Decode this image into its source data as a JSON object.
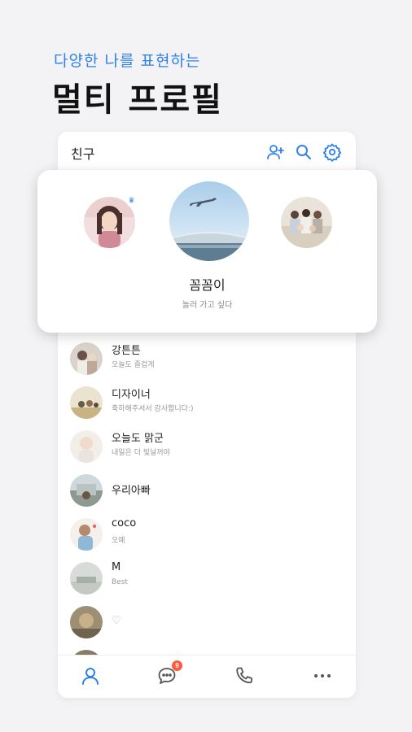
{
  "headline": {
    "subtitle": "다양한 나를 표현하는",
    "title": "멀티 프로필"
  },
  "topbar": {
    "title": "친구",
    "icons": [
      "add-friend-icon",
      "search-icon",
      "settings-icon"
    ]
  },
  "multi_profile": {
    "active_name": "꼼꼼이",
    "active_status": "놀러 가고 싶다",
    "profiles": [
      "profile-woman",
      "profile-airplane-sky",
      "profile-family"
    ],
    "crown_icon": "crown-icon"
  },
  "friends": [
    {
      "name": "강튼튼",
      "status": "오늘도 즐겁게"
    },
    {
      "name": "디자이너",
      "status": "축하해주셔서 감사합니다:)"
    },
    {
      "name": "오늘도 맑군",
      "status": "내일은 더 빛날꺼야"
    },
    {
      "name": "우리아빠",
      "status": ""
    },
    {
      "name": "coco",
      "status": "오예"
    },
    {
      "name": "M",
      "status": "Best"
    },
    {
      "name": "",
      "status": "♡"
    }
  ],
  "bottomnav": {
    "chat_badge": "9",
    "icons": [
      "friends-icon",
      "chat-icon",
      "call-icon",
      "more-icon"
    ]
  },
  "colors": {
    "accent": "#2f80ed",
    "badge": "#ff5a3c",
    "background": "#f3f3f5"
  }
}
